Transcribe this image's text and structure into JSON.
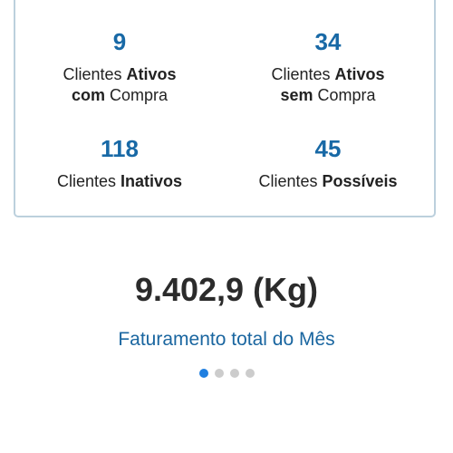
{
  "stats": {
    "active_with_purchase": {
      "value": "9",
      "line1_regular": "Clientes ",
      "line1_bold": "Ativos",
      "line2_bold": "com",
      "line2_regular": " Compra"
    },
    "active_without_purchase": {
      "value": "34",
      "line1_regular": "Clientes ",
      "line1_bold": "Ativos",
      "line2_bold": "sem",
      "line2_regular": " Compra"
    },
    "inactive": {
      "value": "118",
      "regular": "Clientes ",
      "bold": "Inativos"
    },
    "possible": {
      "value": "45",
      "regular": "Clientes ",
      "bold": "Possíveis"
    }
  },
  "summary": {
    "total": "9.402,9 (Kg)",
    "caption": "Faturamento total do Mês"
  },
  "pager": {
    "count": 4,
    "active_index": 0
  },
  "colors": {
    "accent": "#1869a6",
    "card_border": "#bcd0dd",
    "active_dot": "#1f7fe0",
    "inactive_dot": "#cccccc"
  }
}
